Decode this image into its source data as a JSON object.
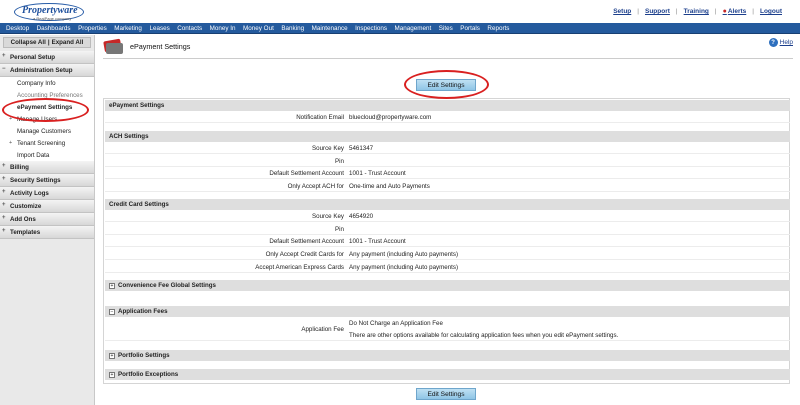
{
  "header": {
    "logo_text": "Propertyware",
    "logo_sub": "a RealPage company",
    "links": [
      "Setup",
      "Support",
      "Training",
      "Alerts",
      "Logout"
    ],
    "separator": "|"
  },
  "nav": [
    "Desktop",
    "Dashboards",
    "Properties",
    "Marketing",
    "Leases",
    "Contacts",
    "Money In",
    "Money Out",
    "Banking",
    "Maintenance",
    "Inspections",
    "Management",
    "Sites",
    "Portals",
    "Reports"
  ],
  "sidebar": {
    "collapse_all": "Collapse All",
    "separator": "|",
    "expand_all": "Expand All",
    "personal_setup": "Personal Setup",
    "admin_setup": "Administration Setup",
    "company_info": "Company Info",
    "accounting_preferences": "Accounting Preferences",
    "epayment_settings": "ePayment Settings",
    "manage_users": "Manage Users",
    "manage_customers": "Manage Customers",
    "tenant_screening": "Tenant Screening",
    "import_data": "Import Data",
    "billing": "Billing",
    "security_settings": "Security Settings",
    "activity_logs": "Activity Logs",
    "customize": "Customize",
    "add_ons": "Add Ons",
    "templates": "Templates",
    "expand_glyph": "+",
    "collapse_glyph": "−"
  },
  "page": {
    "title": "ePayment Settings",
    "help_label": "Help",
    "help_glyph": "?",
    "edit_button": "Edit Settings"
  },
  "sections": {
    "epayment": {
      "title": "ePayment Settings",
      "notification_email_label": "Notification Email",
      "notification_email_value": "bluecloud@propertyware.com"
    },
    "ach": {
      "title": "ACH Settings",
      "source_key_label": "Source Key",
      "source_key_value": "5461347",
      "pin_label": "Pin",
      "settlement_label": "Default Settlement Account",
      "settlement_value": "1001 - Trust Account",
      "only_ach_label": "Only Accept ACH for",
      "only_ach_value": "One-time and Auto Payments"
    },
    "credit_card": {
      "title": "Credit Card Settings",
      "source_key_label": "Source Key",
      "source_key_value": "4654920",
      "pin_label": "Pin",
      "settlement_label": "Default Settlement Account",
      "settlement_value": "1001 - Trust Account",
      "only_cc_label": "Only Accept Credit Cards for",
      "only_cc_value": "Any payment (including Auto payments)",
      "amex_label": "Accept American Express Cards",
      "amex_value": "Any payment (including Auto payments)"
    },
    "convenience": {
      "title": "Convenience Fee Global Settings",
      "toggle": "+"
    },
    "application": {
      "title": "Application Fees",
      "toggle": "−",
      "fee_label": "Application Fee",
      "fee_value": "Do Not Charge an Application Fee",
      "fee_note": "There are other options available for calculating application fees when you edit ePayment settings."
    },
    "portfolio": {
      "title": "Portfolio Settings",
      "toggle": "+"
    },
    "portfolio_exceptions": {
      "title": "Portfolio Exceptions",
      "toggle": "+"
    }
  },
  "colors": {
    "nav_bg": "#245a9d",
    "annotation_ring": "#d92020",
    "button_bg": "#a8d3ee"
  }
}
